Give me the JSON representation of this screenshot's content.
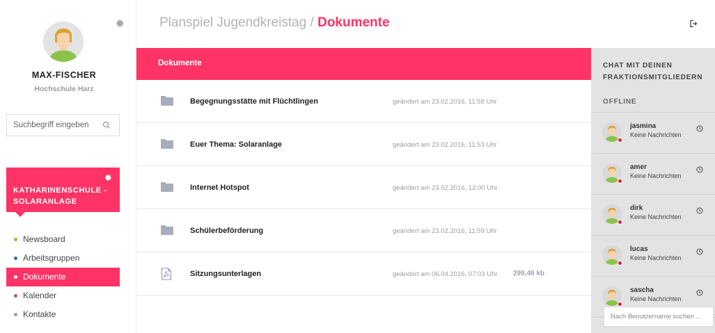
{
  "user": {
    "name": "MAX-FISCHER",
    "school": "Hochschule Harz"
  },
  "search": {
    "placeholder": "Suchbegriff eingeben"
  },
  "group": {
    "name": "KATHARINENSCHULE - SOLARANLAGE"
  },
  "nav": [
    {
      "label": "Newsboard",
      "color": "#8bc34a",
      "active": false
    },
    {
      "label": "Arbeitsgruppen",
      "color": "#2a6db5",
      "active": false
    },
    {
      "label": "Dokumente",
      "color": "#ffffff",
      "active": true
    },
    {
      "label": "Kalender",
      "color": "#c2459a",
      "active": false
    },
    {
      "label": "Kontakte",
      "color": "#a89a87",
      "active": false
    }
  ],
  "header": {
    "prefix": "Planspiel Jugendkreistag / ",
    "current": "Dokumente"
  },
  "documents": {
    "header": "Dokumente",
    "rows": [
      {
        "icon": "folder-icon",
        "name": "Begegnungsstätte mit Flüchtlingen",
        "date": "geändert am 23.02.2016, 11:58 Uhr",
        "size": ""
      },
      {
        "icon": "folder-icon",
        "name": "Euer Thema: Solaranlage",
        "date": "geändert am 23.02.2016, 11:53 Uhr",
        "size": ""
      },
      {
        "icon": "folder-icon",
        "name": "Internet Hotspot",
        "date": "geändert am 23.02.2016, 12:00 Uhr",
        "size": ""
      },
      {
        "icon": "folder-icon",
        "name": "Schülerbeförderung",
        "date": "geändert am 23.02.2016, 11:59 Uhr",
        "size": ""
      },
      {
        "icon": "pdf-file-icon",
        "name": "Sitzungsunterlagen",
        "date": "geändert am 06.04.2016, 07:03 Uhr",
        "size": "299,46 kb"
      }
    ]
  },
  "chat": {
    "title": "CHAT MIT DEINEN FRAKTIONSMITGLIEDERN",
    "offline_label": "OFFLINE",
    "contacts": [
      {
        "name": "jasmina",
        "message": "Keine Nachrichten"
      },
      {
        "name": "amer",
        "message": "Keine Nachrichten"
      },
      {
        "name": "dirk",
        "message": "Keine Nachrichten"
      },
      {
        "name": "lucas",
        "message": "Keine Nachrichten"
      },
      {
        "name": "sascha",
        "message": "Keine Nachrichten"
      }
    ],
    "search_placeholder": "Nach Benutzername suchen ..."
  },
  "colors": {
    "accent": "#ff3366",
    "chat_bg": "#e3e3e3",
    "offline_status": "#e01c3a",
    "folder_icon": "#a7adbb"
  }
}
